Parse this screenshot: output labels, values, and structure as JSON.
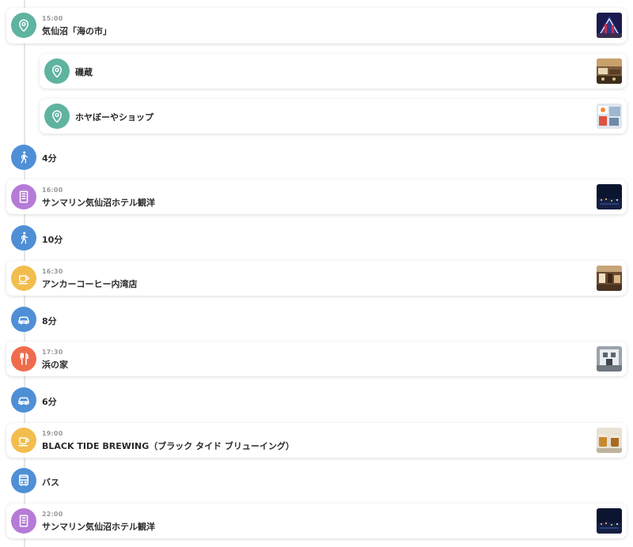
{
  "colors": {
    "place": "#5fb3a1",
    "walk": "#4f8fd6",
    "car": "#4f8fd6",
    "bus": "#4f8fd6",
    "hotel": "#b57bd6",
    "cafe": "#f2bd4d",
    "restaurant": "#ee6c4d"
  },
  "items": [
    {
      "type": "place",
      "icon": "map-pin-icon",
      "time": "15:00",
      "title": "気仙沼「海の市」"
    },
    {
      "type": "subplace",
      "icon": "map-pin-icon",
      "title": "磯蔵"
    },
    {
      "type": "subplace",
      "icon": "map-pin-icon",
      "title": "ホヤぼーやショップ"
    },
    {
      "type": "move",
      "icon": "walk-icon",
      "duration": "4分"
    },
    {
      "type": "hotel",
      "icon": "hotel-icon",
      "time": "16:00",
      "title": "サンマリン気仙沼ホテル観洋"
    },
    {
      "type": "move",
      "icon": "walk-icon",
      "duration": "10分"
    },
    {
      "type": "cafe",
      "icon": "coffee-cup-icon",
      "time": "16:30",
      "title": "アンカーコーヒー内湾店"
    },
    {
      "type": "move",
      "icon": "car-icon",
      "duration": "8分"
    },
    {
      "type": "restaurant",
      "icon": "fork-knife-icon",
      "time": "17:30",
      "title": "浜の家"
    },
    {
      "type": "move",
      "icon": "car-icon",
      "duration": "6分"
    },
    {
      "type": "cafe",
      "icon": "coffee-cup-icon",
      "time": "19:00",
      "title": "BLACK TIDE BREWING（ブラック タイド ブリューイング）"
    },
    {
      "type": "move",
      "icon": "bus-icon",
      "duration": "バス"
    },
    {
      "type": "hotel",
      "icon": "hotel-icon",
      "time": "22:00",
      "title": "サンマリン気仙沼ホテル観洋"
    }
  ]
}
